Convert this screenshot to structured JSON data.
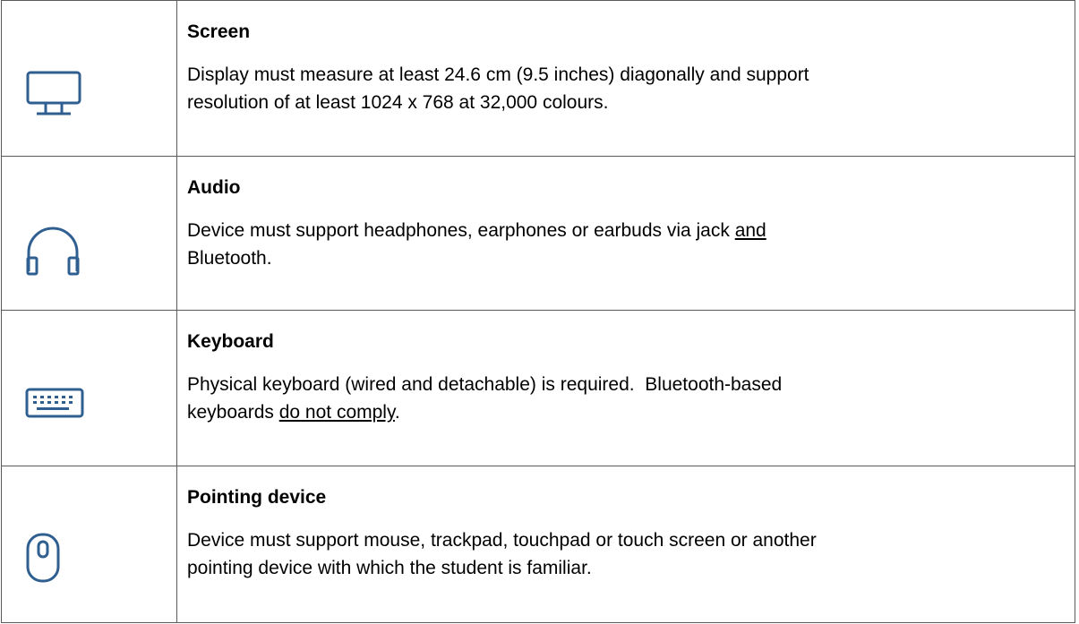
{
  "colors": {
    "icon_stroke": "#2f5f91",
    "border": "#5a5a5a"
  },
  "rows": [
    {
      "icon": "monitor-icon",
      "title": "Screen",
      "desc_line1": "Display must measure at least 24.6 cm (9.5 inches) diagonally and support",
      "desc_line2": "resolution of at least 1024 x 768 at 32,000 colours."
    },
    {
      "icon": "headphones-icon",
      "title": "Audio",
      "desc_a": "Device must support headphones, earphones or earbuds via jack ",
      "desc_underline": "and",
      "desc_b": "Bluetooth."
    },
    {
      "icon": "keyboard-icon",
      "title": "Keyboard",
      "desc_a": "Physical keyboard (wired and detachable) is required.  Bluetooth-based",
      "desc_b_pre": "keyboards ",
      "desc_underline": "do not comply",
      "desc_b_post": "."
    },
    {
      "icon": "mouse-icon",
      "title": "Pointing device",
      "desc_line1": "Device must support mouse, trackpad, touchpad or touch screen or another",
      "desc_line2": "pointing device with which the student is familiar."
    }
  ]
}
